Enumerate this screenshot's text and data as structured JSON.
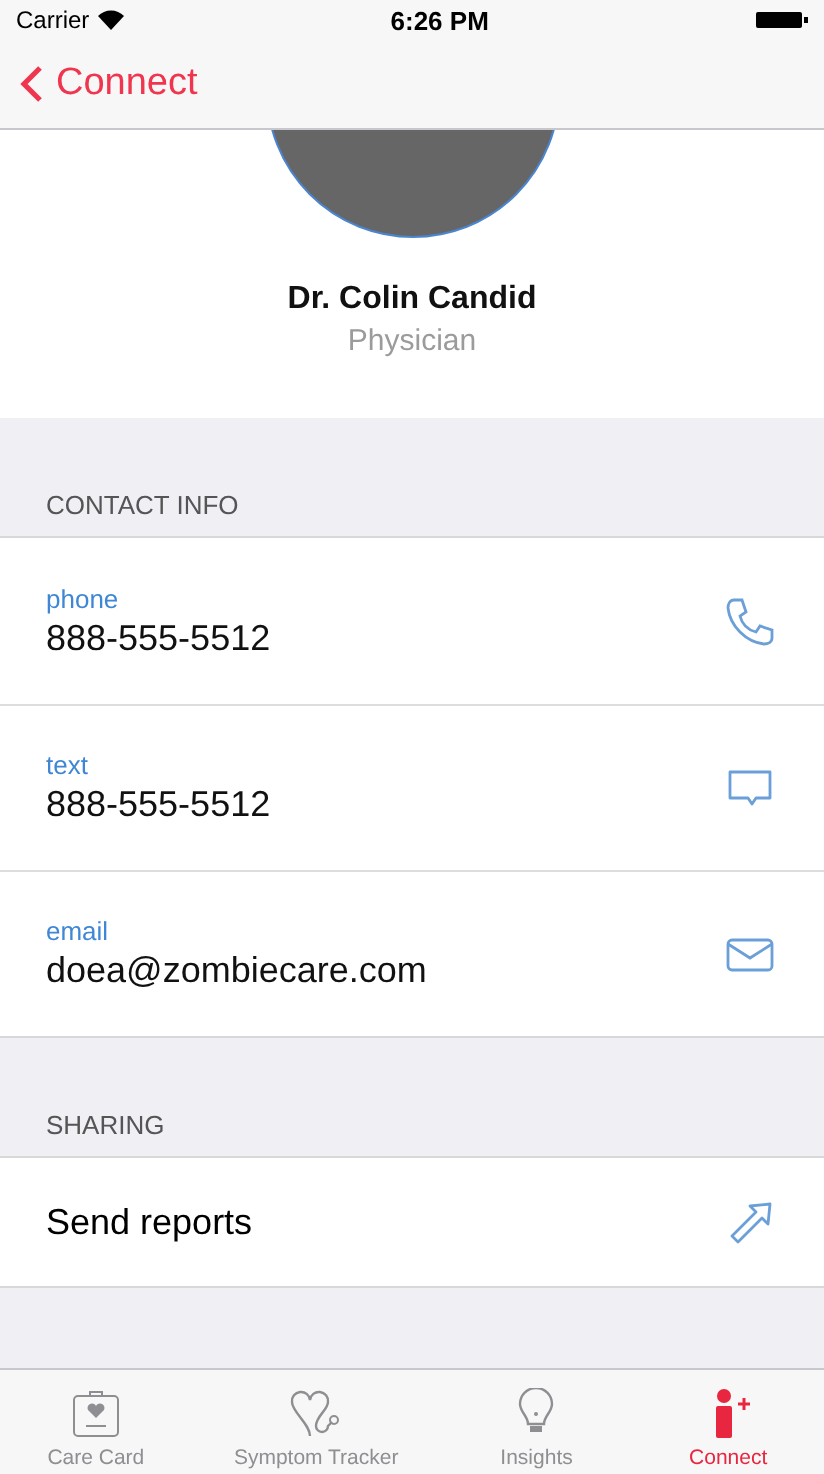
{
  "status_bar": {
    "carrier": "Carrier",
    "time": "6:26 PM"
  },
  "nav_bar": {
    "back_label": "Connect"
  },
  "profile": {
    "name": "Dr. Colin Candid",
    "role": "Physician"
  },
  "contact_section": {
    "title": "CONTACT INFO",
    "items": [
      {
        "label": "phone",
        "value": "888-555-5512"
      },
      {
        "label": "text",
        "value": "888-555-5512"
      },
      {
        "label": "email",
        "value": "doea@zombiecare.com"
      }
    ]
  },
  "sharing_section": {
    "title": "SHARING",
    "items": [
      {
        "label": "Send reports"
      }
    ]
  },
  "tab_bar": [
    {
      "label": "Care Card",
      "selected": false
    },
    {
      "label": "Symptom Tracker",
      "selected": false
    },
    {
      "label": "Insights",
      "selected": false
    },
    {
      "label": "Connect",
      "selected": true
    }
  ]
}
